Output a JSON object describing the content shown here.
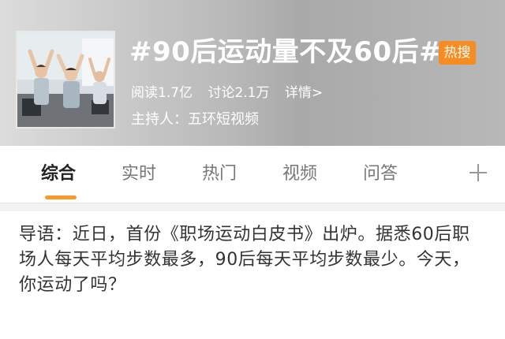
{
  "header": {
    "title": "#90后运动量不及60后#",
    "badge": "热搜",
    "stats": {
      "reads": "阅读1.7亿",
      "discussions": "讨论2.1万",
      "detail_link": "详情>"
    },
    "host": "主持人：五环短视频"
  },
  "tabs": [
    {
      "label": "综合",
      "active": true
    },
    {
      "label": "实时",
      "active": false
    },
    {
      "label": "热门",
      "active": false
    },
    {
      "label": "视频",
      "active": false
    },
    {
      "label": "问答",
      "active": false
    }
  ],
  "intro": {
    "text": "导语：近日，首份《职场运动白皮书》出炉。据悉60后职场人每天平均步数最多，90后每天平均步数最少。今天，你运动了吗？"
  },
  "colors": {
    "accent": "#f79a27",
    "badge": "#f78c22"
  },
  "icons": {
    "add_tab": "plus-icon"
  }
}
